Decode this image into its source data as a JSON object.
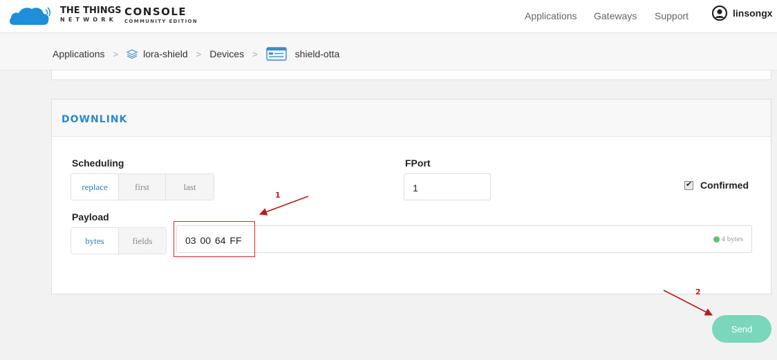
{
  "topbar": {
    "brand_top": "THE THINGS",
    "brand_bottom": "NETWORK",
    "console_top": "CONSOLE",
    "console_bottom": "COMMUNITY EDITION",
    "nav": [
      "Applications",
      "Gateways",
      "Support"
    ],
    "username": "linsongx"
  },
  "breadcrumb": {
    "items": [
      "Applications",
      "lora-shield",
      "Devices",
      "shield-otta"
    ],
    "separator": ">"
  },
  "downlink": {
    "title": "DOWNLINK",
    "scheduling_label": "Scheduling",
    "scheduling_options": [
      "replace",
      "first",
      "last"
    ],
    "scheduling_selected": "replace",
    "fport_label": "FPort",
    "fport_value": "1",
    "confirmed_label": "Confirmed",
    "confirmed_checked": true,
    "payload_label": "Payload",
    "payload_modes": [
      "bytes",
      "fields"
    ],
    "payload_mode_selected": "bytes",
    "payload_value": "03 00 64 FF",
    "payload_size": "4 bytes",
    "send_label": "Send"
  },
  "annotations": {
    "step1": "1",
    "step2": "2"
  },
  "colors": {
    "accent_blue": "#2a89c9",
    "send_button": "#7ad7bb",
    "annotation_red": "#c21f1f",
    "valid_green": "#5ec56b"
  },
  "icons": {
    "logo": "ttn-cloud-logo",
    "user": "user-avatar-icon",
    "application": "layers-icon",
    "device": "device-card-icon",
    "valid": "check-circle-icon"
  }
}
